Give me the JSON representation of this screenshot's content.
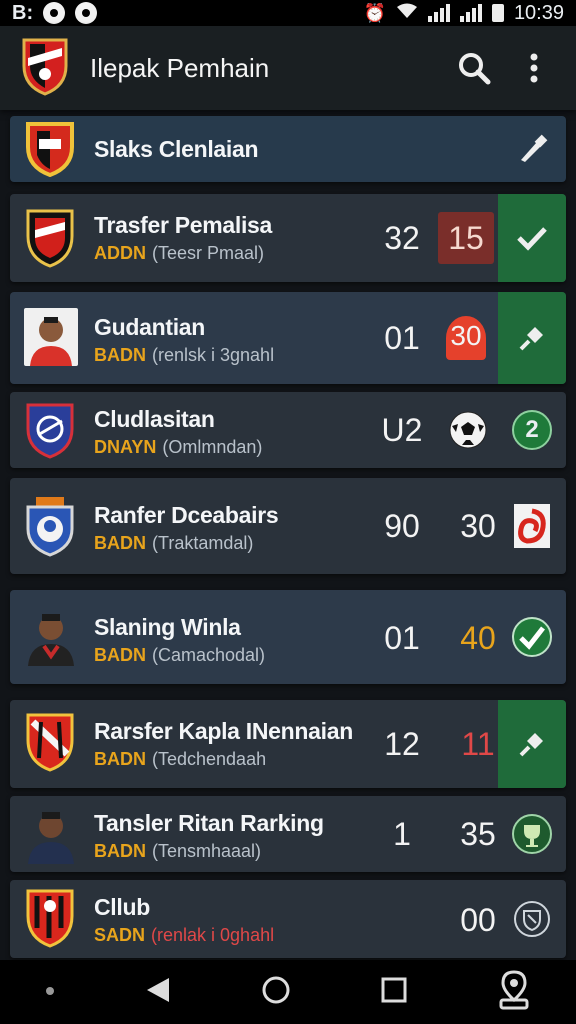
{
  "status_bar": {
    "left_text": "B:",
    "time": "10:39"
  },
  "app_bar": {
    "title": "Ilepak Pemhain",
    "search_icon": "search-icon",
    "menu_icon": "more-vert-icon"
  },
  "rows": [
    {
      "name": "Slaks Clenlaian",
      "tag": "",
      "sub": "",
      "num1": "",
      "num2": "",
      "action_icon": "pencil-icon"
    },
    {
      "name": "Trasfer Pemalisa",
      "tag": "ADDN",
      "sub": "(Teesr Pmaal)",
      "num1": "32",
      "num2": "15",
      "action_icon": "check-icon"
    },
    {
      "name": "Gudantian",
      "tag": "BADN",
      "sub": "(renlsk i 3gnahl",
      "num1": "01",
      "num2": "30",
      "action_icon": "pin-icon"
    },
    {
      "name": "Cludlasitan",
      "tag": "DNAYN",
      "sub": "(Omlmndan)",
      "num1": "U2",
      "num2": "",
      "action_icon": "number-two-icon",
      "action_label": "2"
    },
    {
      "name": "Ranfer Dceabairs",
      "tag": "BADN",
      "sub": "(Traktamdal)",
      "num1": "90",
      "num2": "30",
      "action_icon": "club-badge-icon"
    },
    {
      "name": "Slaning Winla",
      "tag": "BADN",
      "sub": "(Camachodal)",
      "num1": "01",
      "num2": "40",
      "action_icon": "check-circle-icon"
    },
    {
      "name": "Rarsfer Kapla INennaian",
      "tag": "BADN",
      "sub": "(Tedchendaah",
      "num1": "12",
      "num2": "11",
      "action_icon": "pin-icon"
    },
    {
      "name": "Tansler Ritan Rarking",
      "tag": "BADN",
      "sub": "(Tensmhaaal)",
      "num1": "1",
      "num2": "35",
      "action_icon": "trophy-icon"
    },
    {
      "name": "Cllub",
      "tag": "SADN",
      "sub": "(renlak i 0ghahl",
      "num1": "",
      "num2": "00",
      "action_icon": "shield-icon"
    }
  ],
  "colors": {
    "accent_green": "#1f6b3a",
    "accent_red": "#7a2e2a",
    "score_orange": "#e8a41c",
    "score_red": "#e04848"
  }
}
